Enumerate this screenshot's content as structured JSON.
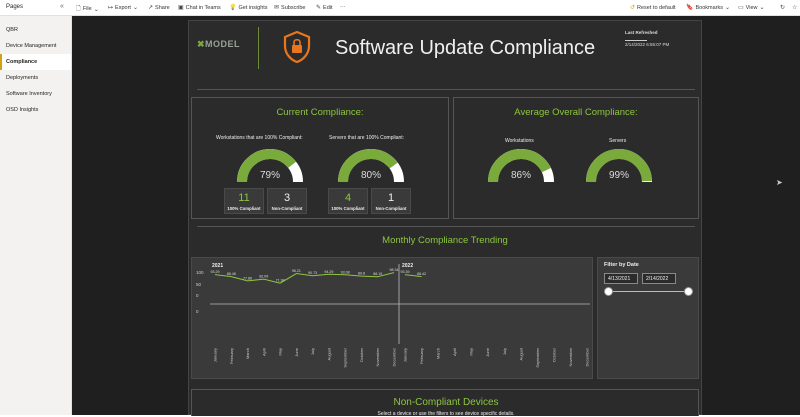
{
  "toolbar": {
    "pages_title": "Pages",
    "file": "File",
    "export": "Export",
    "share": "Share",
    "chat": "Chat in Teams",
    "insights": "Get insights",
    "subscribe": "Subscribe",
    "edit": "Edit",
    "more": "···",
    "reset": "Reset to default",
    "bookmarks": "Bookmarks",
    "view": "View"
  },
  "sidebar": {
    "items": [
      {
        "label": "QBR"
      },
      {
        "label": "Device Management"
      },
      {
        "label": "Compliance"
      },
      {
        "label": "Deployments"
      },
      {
        "label": "Software Inventory"
      },
      {
        "label": "OSD Insights"
      }
    ],
    "active_index": 2
  },
  "report": {
    "logo_text": "MODEL",
    "title": "Software Update Compliance",
    "last_refreshed_label": "Last Refreshed",
    "last_refreshed_value": "2/14/2022 6:55:07 PM",
    "current": {
      "title": "Current Compliance:",
      "workstations_label": "Workstations that are 100% Compliant:",
      "servers_label": "Servers that are 100% Compliant:",
      "ws_gauge": {
        "value": 79,
        "display": "79%"
      },
      "sv_gauge": {
        "value": 80,
        "display": "80%"
      },
      "ws_compliant": "11",
      "ws_noncompliant": "3",
      "sv_compliant": "4",
      "sv_noncompliant": "1",
      "compliant_label": "100% Compliant",
      "noncompliant_label": "Non-Compliant"
    },
    "average": {
      "title": "Average Overall Compliance:",
      "ws_label": "Workstations",
      "sv_label": "Servers",
      "ws_gauge": {
        "value": 86,
        "display": "86%"
      },
      "sv_gauge": {
        "value": 99,
        "display": "99%"
      }
    },
    "trending_title": "Monthly Compliance Trending",
    "filter": {
      "title": "Filter by Date",
      "start": "4/13/2021",
      "end": "2/14/2022"
    },
    "noncompliant": {
      "title": "Non-Compliant Devices",
      "subtitle": "Select a device or use the filters to see device specific details."
    }
  },
  "colors": {
    "accent_green": "#8dc63f",
    "gauge_green": "#7aa93c",
    "gauge_bg": "#ffffff",
    "canvas": "#1f1f1f",
    "panel": "#2b2b2b",
    "shield": "#e8761e"
  },
  "chart_data": {
    "type": "line",
    "title": "Monthly Compliance Trending",
    "panels": [
      {
        "year": "2021",
        "categories": [
          "January",
          "February",
          "March",
          "April",
          "May",
          "June",
          "July",
          "August",
          "September",
          "October",
          "November",
          "December"
        ],
        "values": [
          93.29,
          88.48,
          77.86,
          82.09,
          71.98,
          96.21,
          90.73,
          94.29,
          93.08,
          89.8,
          88.19,
          98.34
        ]
      },
      {
        "year": "2022",
        "categories": [
          "January",
          "February",
          "March",
          "April",
          "May",
          "June",
          "July",
          "August",
          "September",
          "October",
          "November",
          "December"
        ],
        "values": [
          93.39,
          88.42
        ]
      }
    ],
    "y_ticks": [
      "100",
      "50",
      "0",
      "0"
    ],
    "ylim": [
      0,
      100
    ],
    "line_color": "#8dc63f"
  }
}
